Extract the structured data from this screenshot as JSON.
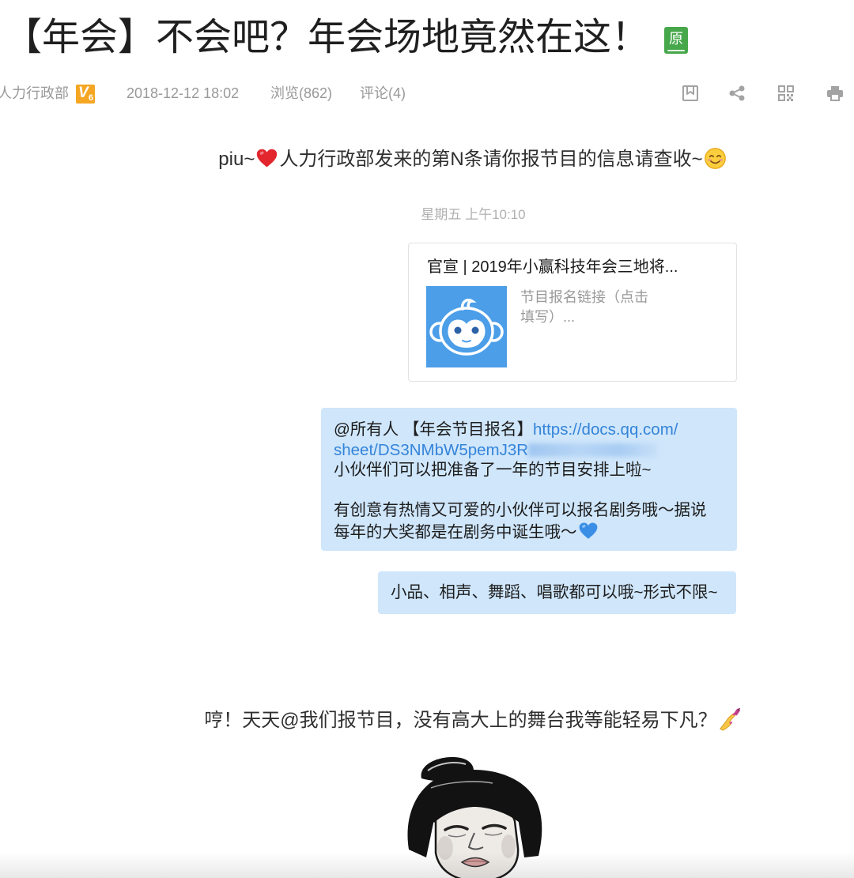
{
  "theme": {
    "title_text": "#1f1f1f",
    "meta_text": "#999999",
    "original_badge": "#46a84b",
    "level_badge": "#f5a623",
    "thumbnail_background": "#4c9ee8",
    "bubble_background": "#cfe6fb",
    "link": "#3484d9"
  },
  "article": {
    "title": "【年会】不会吧？年会场地竟然在这！",
    "original_badge": "原",
    "meta": {
      "author": "人力行政部",
      "level_badge_letter": "V",
      "level_badge_number": "6",
      "datetime": "2018-12-12 18:02",
      "views": "浏览(862)",
      "comments": "评论(4)"
    },
    "actions": [
      "bookmark-icon",
      "share-icon",
      "qr-code-icon",
      "print-icon"
    ]
  },
  "body": {
    "intro": {
      "prefix": "piu~",
      "icon_1": "red-heart-icon",
      "text": "人力行政部发来的第N条请你报节目的信息请查收~",
      "icon_2": "smiling-face-icon"
    },
    "chat_screenshot": {
      "timestamp": "星期五 上午10:10",
      "shared_card": {
        "title": "官宣 | 2019年小赢科技年会三地将...",
        "thumbnail_icon": "monkey-avatar-icon",
        "description": "节目报名链接（点击填写）..."
      },
      "message_1": {
        "lead": "@所有人 【年会节目报名】",
        "link_line_1": "https://docs.qq.com/",
        "link_line_2": "sheet/DS3NMbW5pemJ3R",
        "line_3": "小伙伴们可以把准备了一年的节目安排上啦~",
        "line_5": "有创意有热情又可爱的小伙伴可以报名剧务哦～据说",
        "line_6": "每年的大奖都是在剧务中诞生哦～",
        "line_6_icon": "blue-heart-icon"
      },
      "message_2": "小品、相声、舞蹈、唱歌都可以哦~形式不限~"
    },
    "reaction": {
      "text": "哼！天天@我们报节目，没有高大上的舞台我等能轻易下凡？",
      "icon": "nail-polish-icon"
    }
  }
}
